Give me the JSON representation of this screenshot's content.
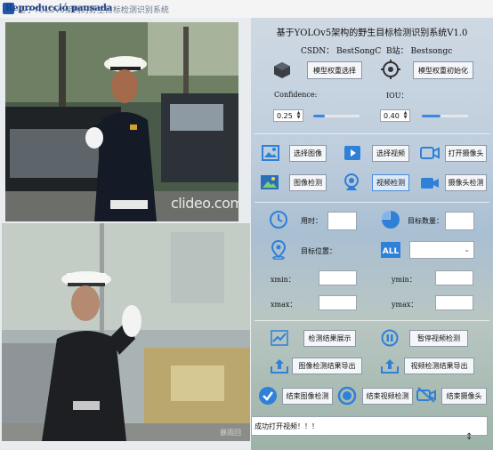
{
  "window": {
    "title": "基于YOLOv5架构的野生目标检测识别系统",
    "overlay_text": "Reproducció pausada"
  },
  "video_top": {
    "watermark": "clideo.com"
  },
  "video_bottom": {
    "watermark": "暴雨回"
  },
  "panel": {
    "title": "基于YOLOv5架构的野生目标检测识别系统V1.0",
    "csdn": "CSDN：  BestSongC",
    "bilibili": "B站：  Bestsongc",
    "model_select": "模型权重选择",
    "model_init": "模型权重初始化",
    "confidence_label": "Confidence:",
    "confidence_value": "0.25",
    "confidence_fraction": 0.25,
    "iou_label": "IOU：",
    "iou_value": "0.40",
    "iou_fraction": 0.4,
    "select_image": "选择图像",
    "select_video": "选择视频",
    "open_camera": "打开摄像头",
    "image_detect": "图像检测",
    "video_detect": "视频检测",
    "camera_detect": "摄像头检测",
    "time_label": "用时：",
    "count_label": "目标数量：",
    "position_label": "目标位置：",
    "select_value": "",
    "xmin_label": "xmin：",
    "ymin_label": "ymin：",
    "xmax_label": "xmax：",
    "ymax_label": "ymax：",
    "result_show": "检测结果展示",
    "pause_video": "暂停视频检测",
    "export_image": "图像检测结果导出",
    "export_video": "视频检测结果导出",
    "end_image": "结束图像检测",
    "end_video": "结束视频检测",
    "end_camera": "结束摄像头",
    "status": "成功打开视频！！！"
  },
  "colors": {
    "accent": "#2f80d8",
    "active_button": "#dbe9f8"
  }
}
